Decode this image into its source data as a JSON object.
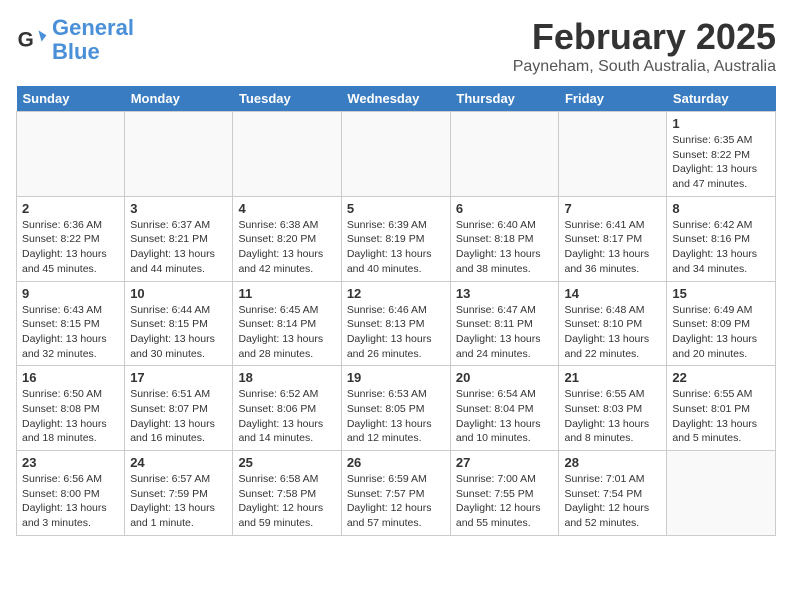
{
  "header": {
    "logo_line1": "General",
    "logo_line2": "Blue",
    "month": "February 2025",
    "location": "Payneham, South Australia, Australia"
  },
  "days_of_week": [
    "Sunday",
    "Monday",
    "Tuesday",
    "Wednesday",
    "Thursday",
    "Friday",
    "Saturday"
  ],
  "weeks": [
    [
      {
        "day": "",
        "info": ""
      },
      {
        "day": "",
        "info": ""
      },
      {
        "day": "",
        "info": ""
      },
      {
        "day": "",
        "info": ""
      },
      {
        "day": "",
        "info": ""
      },
      {
        "day": "",
        "info": ""
      },
      {
        "day": "1",
        "info": "Sunrise: 6:35 AM\nSunset: 8:22 PM\nDaylight: 13 hours\nand 47 minutes."
      }
    ],
    [
      {
        "day": "2",
        "info": "Sunrise: 6:36 AM\nSunset: 8:22 PM\nDaylight: 13 hours\nand 45 minutes."
      },
      {
        "day": "3",
        "info": "Sunrise: 6:37 AM\nSunset: 8:21 PM\nDaylight: 13 hours\nand 44 minutes."
      },
      {
        "day": "4",
        "info": "Sunrise: 6:38 AM\nSunset: 8:20 PM\nDaylight: 13 hours\nand 42 minutes."
      },
      {
        "day": "5",
        "info": "Sunrise: 6:39 AM\nSunset: 8:19 PM\nDaylight: 13 hours\nand 40 minutes."
      },
      {
        "day": "6",
        "info": "Sunrise: 6:40 AM\nSunset: 8:18 PM\nDaylight: 13 hours\nand 38 minutes."
      },
      {
        "day": "7",
        "info": "Sunrise: 6:41 AM\nSunset: 8:17 PM\nDaylight: 13 hours\nand 36 minutes."
      },
      {
        "day": "8",
        "info": "Sunrise: 6:42 AM\nSunset: 8:16 PM\nDaylight: 13 hours\nand 34 minutes."
      }
    ],
    [
      {
        "day": "9",
        "info": "Sunrise: 6:43 AM\nSunset: 8:15 PM\nDaylight: 13 hours\nand 32 minutes."
      },
      {
        "day": "10",
        "info": "Sunrise: 6:44 AM\nSunset: 8:15 PM\nDaylight: 13 hours\nand 30 minutes."
      },
      {
        "day": "11",
        "info": "Sunrise: 6:45 AM\nSunset: 8:14 PM\nDaylight: 13 hours\nand 28 minutes."
      },
      {
        "day": "12",
        "info": "Sunrise: 6:46 AM\nSunset: 8:13 PM\nDaylight: 13 hours\nand 26 minutes."
      },
      {
        "day": "13",
        "info": "Sunrise: 6:47 AM\nSunset: 8:11 PM\nDaylight: 13 hours\nand 24 minutes."
      },
      {
        "day": "14",
        "info": "Sunrise: 6:48 AM\nSunset: 8:10 PM\nDaylight: 13 hours\nand 22 minutes."
      },
      {
        "day": "15",
        "info": "Sunrise: 6:49 AM\nSunset: 8:09 PM\nDaylight: 13 hours\nand 20 minutes."
      }
    ],
    [
      {
        "day": "16",
        "info": "Sunrise: 6:50 AM\nSunset: 8:08 PM\nDaylight: 13 hours\nand 18 minutes."
      },
      {
        "day": "17",
        "info": "Sunrise: 6:51 AM\nSunset: 8:07 PM\nDaylight: 13 hours\nand 16 minutes."
      },
      {
        "day": "18",
        "info": "Sunrise: 6:52 AM\nSunset: 8:06 PM\nDaylight: 13 hours\nand 14 minutes."
      },
      {
        "day": "19",
        "info": "Sunrise: 6:53 AM\nSunset: 8:05 PM\nDaylight: 13 hours\nand 12 minutes."
      },
      {
        "day": "20",
        "info": "Sunrise: 6:54 AM\nSunset: 8:04 PM\nDaylight: 13 hours\nand 10 minutes."
      },
      {
        "day": "21",
        "info": "Sunrise: 6:55 AM\nSunset: 8:03 PM\nDaylight: 13 hours\nand 8 minutes."
      },
      {
        "day": "22",
        "info": "Sunrise: 6:55 AM\nSunset: 8:01 PM\nDaylight: 13 hours\nand 5 minutes."
      }
    ],
    [
      {
        "day": "23",
        "info": "Sunrise: 6:56 AM\nSunset: 8:00 PM\nDaylight: 13 hours\nand 3 minutes."
      },
      {
        "day": "24",
        "info": "Sunrise: 6:57 AM\nSunset: 7:59 PM\nDaylight: 13 hours\nand 1 minute."
      },
      {
        "day": "25",
        "info": "Sunrise: 6:58 AM\nSunset: 7:58 PM\nDaylight: 12 hours\nand 59 minutes."
      },
      {
        "day": "26",
        "info": "Sunrise: 6:59 AM\nSunset: 7:57 PM\nDaylight: 12 hours\nand 57 minutes."
      },
      {
        "day": "27",
        "info": "Sunrise: 7:00 AM\nSunset: 7:55 PM\nDaylight: 12 hours\nand 55 minutes."
      },
      {
        "day": "28",
        "info": "Sunrise: 7:01 AM\nSunset: 7:54 PM\nDaylight: 12 hours\nand 52 minutes."
      },
      {
        "day": "",
        "info": ""
      }
    ]
  ]
}
